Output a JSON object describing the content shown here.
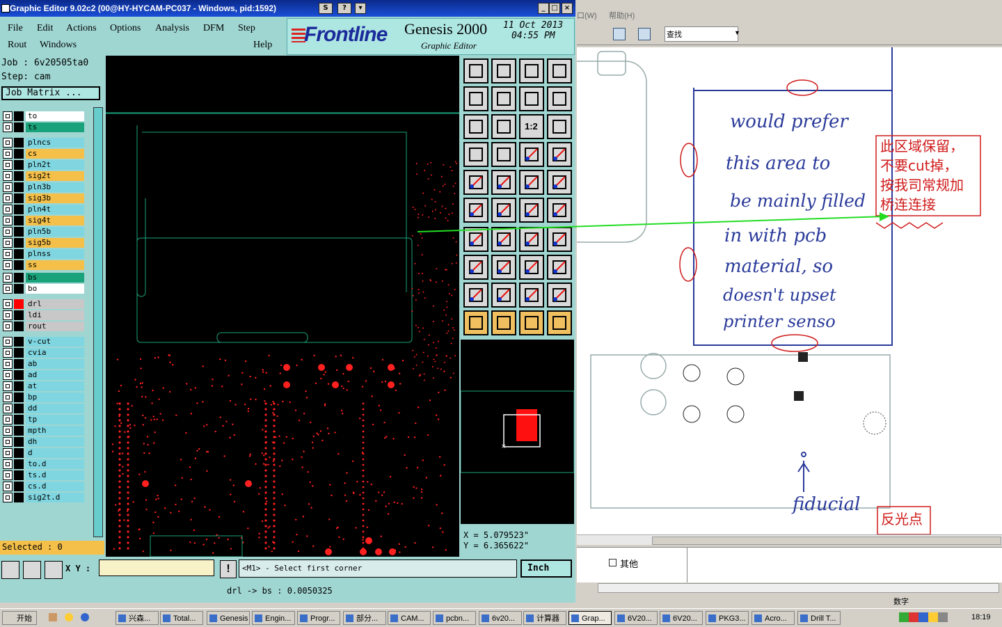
{
  "genesis": {
    "title": "Graphic Editor 9.02c2 (00@HY-HYCAM-PC037 - Windows, pid:1592)",
    "window_buttons": [
      "_",
      "□",
      "×"
    ],
    "menu_row1": [
      "File",
      "Edit",
      "Actions",
      "Options",
      "Analysis",
      "DFM",
      "Step"
    ],
    "menu_row2": [
      "Rout",
      "Windows",
      "Help"
    ],
    "logo": "Frontline",
    "product": "Genesis 2000",
    "subtitle": "Graphic Editor",
    "date": "11 Oct 2013",
    "time": "04:55 PM",
    "job_label": "Job  :  6v20505ta0",
    "step_label": "Step: cam",
    "job_matrix": "Job Matrix ...",
    "layers": [
      {
        "name": "to",
        "bg": "#ffffff"
      },
      {
        "name": "ts",
        "bg": "#1aa37a"
      },
      {
        "name": "plncs",
        "bg": "#7fd6e0"
      },
      {
        "name": "cs",
        "bg": "#f5c04a"
      },
      {
        "name": "pln2t",
        "bg": "#7fd6e0"
      },
      {
        "name": "sig2t",
        "bg": "#f5c04a"
      },
      {
        "name": "pln3b",
        "bg": "#7fd6e0"
      },
      {
        "name": "sig3b",
        "bg": "#f5c04a"
      },
      {
        "name": "pln4t",
        "bg": "#7fd6e0"
      },
      {
        "name": "sig4t",
        "bg": "#f5c04a"
      },
      {
        "name": "pln5b",
        "bg": "#7fd6e0"
      },
      {
        "name": "sig5b",
        "bg": "#f5c04a"
      },
      {
        "name": "plnss",
        "bg": "#7fd6e0"
      },
      {
        "name": "ss",
        "bg": "#f5c04a"
      },
      {
        "name": "bs",
        "bg": "#1aa37a"
      },
      {
        "name": "bo",
        "bg": "#ffffff"
      },
      {
        "name": "drl",
        "bg": "#c8c8c8"
      },
      {
        "name": "ldi",
        "bg": "#c8c8c8"
      },
      {
        "name": "rout",
        "bg": "#c8c8c8"
      },
      {
        "name": "v-cut",
        "bg": "#7fd6e0"
      },
      {
        "name": "cvia",
        "bg": "#7fd6e0"
      },
      {
        "name": "ab",
        "bg": "#7fd6e0"
      },
      {
        "name": "ad",
        "bg": "#7fd6e0"
      },
      {
        "name": "at",
        "bg": "#7fd6e0"
      },
      {
        "name": "bp",
        "bg": "#7fd6e0"
      },
      {
        "name": "dd",
        "bg": "#7fd6e0"
      },
      {
        "name": "tp",
        "bg": "#7fd6e0"
      },
      {
        "name": "mpth",
        "bg": "#7fd6e0"
      },
      {
        "name": "dh",
        "bg": "#7fd6e0"
      },
      {
        "name": "d",
        "bg": "#7fd6e0"
      },
      {
        "name": "to.d",
        "bg": "#7fd6e0"
      },
      {
        "name": "ts.d",
        "bg": "#7fd6e0"
      },
      {
        "name": "cs.d",
        "bg": "#7fd6e0"
      },
      {
        "name": "sig2t.d",
        "bg": "#7fd6e0"
      }
    ],
    "selected": "Selected : 0",
    "xy_label": "X Y :",
    "prompt": "<M1> - Select first corner",
    "units": "Inch",
    "coord_x": "X  =  5.079523\"",
    "coord_y": "Y  =  6.365622\"",
    "message": "drl -> bs : 0.0050325",
    "tool_12": "1:2"
  },
  "doc": {
    "menu": [
      "口(W)",
      "帮助(H)"
    ],
    "search_label": "查找",
    "handwriting": [
      "would prefer",
      "this area to",
      "be mainly filled",
      "in with pcb",
      "material, so",
      "doesn't upset",
      "printer senso"
    ],
    "fiducial": "fiducial",
    "note_cn": [
      "此区域保留，",
      "不要cut掉，",
      "按我司常规加",
      "桥连连接"
    ],
    "note_reflect": "反光点",
    "checkbox_other": "其他",
    "status_num": "数字"
  },
  "taskbar": {
    "start": "开始",
    "tasks": [
      "兴森...",
      "Total...",
      "Genesis",
      "Engin...",
      "Progr...",
      "部分...",
      "CAM...",
      "pcbn...",
      "6v20...",
      "计算器",
      "Grap...",
      "6V20...",
      "6V20...",
      "PKG3...",
      "Acro...",
      "Drill T..."
    ],
    "clock": "18:19"
  },
  "colors": {
    "canvas_bg": "#000000",
    "accent_red": "#ff0000",
    "green_arrow": "#22dd22",
    "panel": "#9fd6d2"
  }
}
